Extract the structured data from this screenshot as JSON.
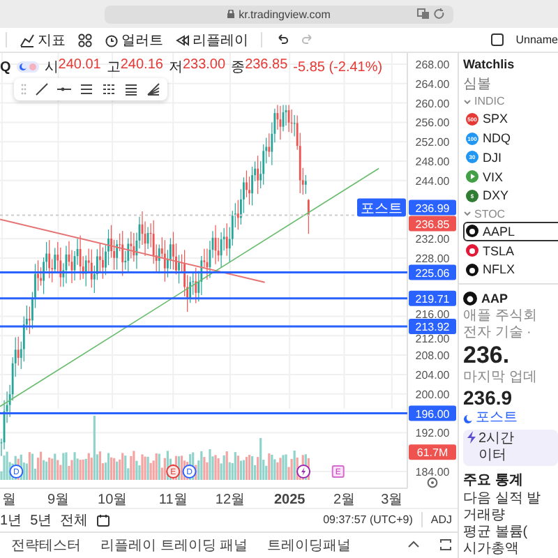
{
  "browser": {
    "url": "kr.tradingview.com"
  },
  "toolbar": {
    "buttons": [
      {
        "kind": "indicators",
        "label": "지표"
      },
      {
        "kind": "templates"
      },
      {
        "kind": "alert",
        "label": "얼러트"
      },
      {
        "kind": "replay",
        "label": "리플레이"
      },
      {
        "kind": "undo"
      },
      {
        "kind": "redo"
      }
    ],
    "layout_name": "Unname"
  },
  "legend": {
    "symbol": "Q",
    "fields": [
      {
        "label": "시",
        "value": "240.01"
      },
      {
        "label": "고",
        "value": "240.16"
      },
      {
        "label": "저",
        "value": "233.00"
      },
      {
        "label": "종",
        "value": "236.85"
      }
    ],
    "change": "-5.85 (-2.41%)"
  },
  "chart": {
    "price_ticks": [
      "268.00",
      "264.00",
      "260.00",
      "256.00",
      "252.00",
      "248.00",
      "244.00",
      "232.00",
      "228.00",
      "216.00",
      "212.00",
      "208.00",
      "204.00",
      "200.00",
      "192.00",
      "184.00"
    ],
    "levels": [
      "225.06",
      "219.71",
      "213.92",
      "196.00"
    ],
    "post_badge": {
      "label": "포스트",
      "price": "236.99"
    },
    "last_price": "236.85",
    "volume_badge": "61.7M",
    "markers": [
      {
        "kind": "dividend",
        "letter": "D"
      },
      {
        "kind": "earnings",
        "letter": "E"
      },
      {
        "kind": "dividend",
        "letter": "D"
      },
      {
        "kind": "split"
      },
      {
        "kind": "upcoming",
        "letter": "E"
      }
    ],
    "time_labels": [
      {
        "label": "월",
        "kind": "month"
      },
      {
        "label": "9월",
        "kind": "month"
      },
      {
        "label": "10월",
        "kind": "month"
      },
      {
        "label": "11월",
        "kind": "month"
      },
      {
        "label": "12월",
        "kind": "month"
      },
      {
        "label": "2025",
        "kind": "year"
      },
      {
        "label": "2월",
        "kind": "month"
      },
      {
        "label": "3월",
        "kind": "month"
      }
    ]
  },
  "range_bar": {
    "ranges": [
      "1년",
      "5년",
      "전체"
    ],
    "clock": "09:37:57 (UTC+9)",
    "adjust": "ADJ"
  },
  "bottom_panel": {
    "tabs": [
      {
        "label": "전략테스터",
        "selected": false
      },
      {
        "label": "리플레이 트레이딩 패널",
        "selected": false
      },
      {
        "label": "트레이딩패널",
        "selected": false
      }
    ]
  },
  "watchlist": {
    "title": "Watchlis",
    "column": "심볼",
    "sections": [
      {
        "title": "INDIC",
        "expanded": true,
        "items": [
          {
            "symbol": "SPX",
            "kind": "badge",
            "badge": "500",
            "color": "#e53935",
            "selected": false
          },
          {
            "symbol": "NDQ",
            "kind": "badge",
            "badge": "100",
            "color": "#2196f3",
            "selected": false
          },
          {
            "symbol": "DJI",
            "kind": "badge",
            "badge": "30",
            "color": "#2196f3",
            "selected": false
          },
          {
            "symbol": "VIX",
            "kind": "play",
            "color": "#43a047",
            "selected": false
          },
          {
            "symbol": "DXY",
            "kind": "badge",
            "badge": "$",
            "color": "#2e7d32",
            "selected": false
          }
        ]
      },
      {
        "title": "STOC",
        "expanded": true,
        "items": [
          {
            "symbol": "AAPL",
            "kind": "logo",
            "color": "#111111",
            "selected": true
          },
          {
            "symbol": "TSLA",
            "kind": "logo",
            "color": "#e31937",
            "selected": false
          },
          {
            "symbol": "NFLX",
            "kind": "logo",
            "color": "#111111",
            "selected": false
          }
        ]
      }
    ]
  },
  "details": {
    "symbol": "AAP",
    "name": "애플 주식회",
    "sector": "전자 기술 ·",
    "price": "236.",
    "updated": "마지막 업데",
    "post_price": "236.9",
    "post_label": "포스트",
    "notice": [
      "2시간",
      "이터"
    ],
    "stats_title": "주요 통계",
    "stats": [
      "다음 실적 발",
      "거래량",
      "평균 볼륨(",
      "시가총액"
    ]
  }
}
